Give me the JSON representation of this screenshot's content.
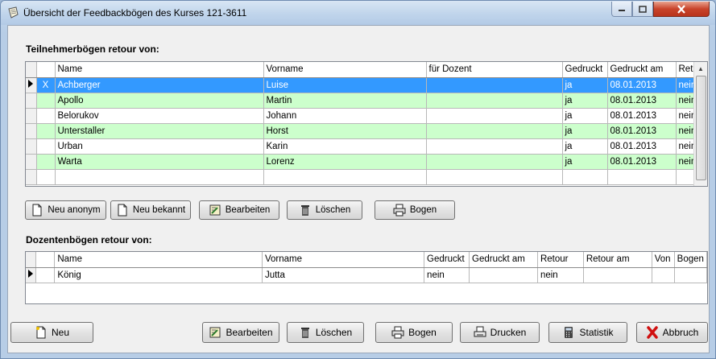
{
  "window": {
    "title": "Übersicht der Feedbackbögen des Kurses 121-3611"
  },
  "participants": {
    "label": "Teilnehmerbögen retour von:",
    "columns": [
      "Name",
      "Vorname",
      "für Dozent",
      "Gedruckt",
      "Gedruckt am",
      "Ret"
    ],
    "rows": [
      {
        "marker": "X",
        "name": "Achberger",
        "vorname": "Luise",
        "dozent": "",
        "gedruckt": "ja",
        "gedruckt_am": "08.01.2013",
        "ret": "nein",
        "style": "sel"
      },
      {
        "marker": "",
        "name": "Apollo",
        "vorname": "Martin",
        "dozent": "",
        "gedruckt": "ja",
        "gedruckt_am": "08.01.2013",
        "ret": "nein",
        "style": "green"
      },
      {
        "marker": "",
        "name": "Belorukov",
        "vorname": "Johann",
        "dozent": "",
        "gedruckt": "ja",
        "gedruckt_am": "08.01.2013",
        "ret": "nein",
        "style": "white"
      },
      {
        "marker": "",
        "name": "Unterstaller",
        "vorname": "Horst",
        "dozent": "",
        "gedruckt": "ja",
        "gedruckt_am": "08.01.2013",
        "ret": "nein",
        "style": "green"
      },
      {
        "marker": "",
        "name": "Urban",
        "vorname": "Karin",
        "dozent": "",
        "gedruckt": "ja",
        "gedruckt_am": "08.01.2013",
        "ret": "nein",
        "style": "white"
      },
      {
        "marker": "",
        "name": "Warta",
        "vorname": "Lorenz",
        "dozent": "",
        "gedruckt": "ja",
        "gedruckt_am": "08.01.2013",
        "ret": "nein",
        "style": "green"
      }
    ],
    "buttons": {
      "neu_anonym": "Neu anonym",
      "neu_bekannt": "Neu bekannt",
      "bearbeiten": "Bearbeiten",
      "loeschen": "Löschen",
      "bogen": "Bogen"
    }
  },
  "lecturers": {
    "label": "Dozentenbögen retour von:",
    "columns": [
      "Name",
      "Vorname",
      "Gedruckt",
      "Gedruckt am",
      "Retour",
      "Retour am",
      "Von",
      "Bogen"
    ],
    "rows": [
      {
        "name": "König",
        "vorname": "Jutta",
        "gedruckt": "nein",
        "gedruckt_am": "",
        "retour": "nein",
        "retour_am": "",
        "von": "",
        "bogen": ""
      }
    ]
  },
  "footer": {
    "neu": "Neu",
    "bearbeiten": "Bearbeiten",
    "loeschen": "Löschen",
    "bogen": "Bogen",
    "drucken": "Drucken",
    "statistik": "Statistik",
    "abbruch": "Abbruch"
  },
  "colors": {
    "selection": "#3399ff",
    "row_green": "#ccffcc"
  }
}
